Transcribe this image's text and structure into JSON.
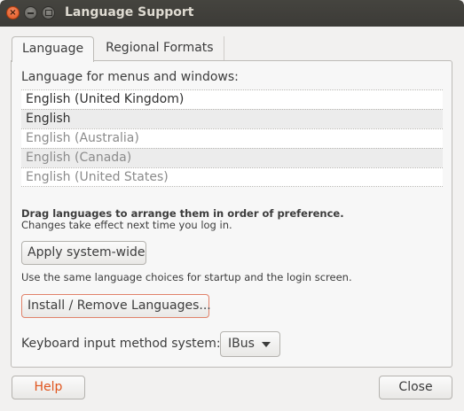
{
  "window": {
    "title": "Language Support"
  },
  "tabs": [
    {
      "label": "Language"
    },
    {
      "label": "Regional Formats"
    }
  ],
  "language_tab": {
    "section_label": "Language for menus and windows:",
    "languages": [
      {
        "label": "English (United Kingdom)",
        "active": true
      },
      {
        "label": "English",
        "active": true
      },
      {
        "label": "English (Australia)",
        "active": false
      },
      {
        "label": "English (Canada)",
        "active": false
      },
      {
        "label": "English (United States)",
        "active": false
      }
    ],
    "drag_hint": "Drag languages to arrange them in order of preference.",
    "effect_hint": "Changes take effect next time you log in.",
    "apply_button": "Apply system-wide",
    "apply_description": "Use the same language choices for startup and the login screen.",
    "install_button": "Install / Remove Languages...",
    "keyboard_label": "Keyboard input method system:",
    "keyboard_value": "IBus"
  },
  "footer": {
    "help_button": "Help",
    "close_button": "Close"
  },
  "colors": {
    "titlebar": "#3c3b37",
    "accent": "#e0541d"
  }
}
